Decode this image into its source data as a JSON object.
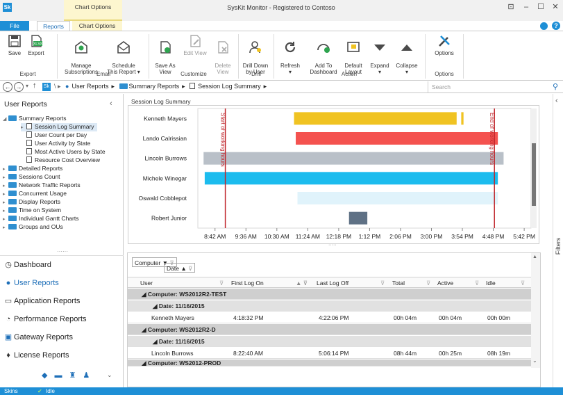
{
  "window": {
    "title": "SysKit Monitor - Registered to Contoso",
    "context_header": "Chart Options",
    "app_icon": "Sk"
  },
  "tabs": [
    {
      "label": "File"
    },
    {
      "label": "Reports"
    },
    {
      "label": "Chart Options"
    }
  ],
  "ribbon": {
    "buttons": [
      {
        "label": "Save",
        "icon": "save-icon"
      },
      {
        "label": "Export",
        "icon": "xlsx-export-icon"
      },
      {
        "label": "Manage\nSubscriptions",
        "icon": "subscriptions-icon"
      },
      {
        "label": "Schedule\nThis Report ▾",
        "icon": "schedule-mail-icon"
      },
      {
        "label": "Save As\nView",
        "icon": "save-view-icon"
      },
      {
        "label": "Edit View",
        "icon": "edit-view-icon"
      },
      {
        "label": "Delete\nView",
        "icon": "delete-view-icon"
      },
      {
        "label": "Drill Down\nby User",
        "icon": "drill-down-icon"
      },
      {
        "label": "Refresh\n▾",
        "icon": "refresh-icon"
      },
      {
        "label": "Add To\nDashboard",
        "icon": "add-dashboard-icon"
      },
      {
        "label": "Default\nLayout",
        "icon": "default-layout-icon"
      },
      {
        "label": "Expand\n▾",
        "icon": "expand-icon"
      },
      {
        "label": "Collapse\n▾",
        "icon": "collapse-icon"
      },
      {
        "label": "Options",
        "icon": "options-tools-icon"
      }
    ],
    "groups": [
      "Export",
      "Email",
      "Customize",
      "Drill",
      "Action",
      "Options"
    ]
  },
  "address": {
    "crumbs": [
      "User Reports",
      "Summary Reports",
      "Session Log Summary"
    ],
    "search_placeholder": "Search"
  },
  "left": {
    "title": "User Reports",
    "tree": [
      {
        "label": "Summary Reports",
        "kind": "folder"
      },
      {
        "label": "Session Log Summary",
        "kind": "report",
        "selected": true
      },
      {
        "label": "User Count per Day",
        "kind": "report"
      },
      {
        "label": "User Activity by State",
        "kind": "report"
      },
      {
        "label": "Most Active Users by State",
        "kind": "report"
      },
      {
        "label": "Resource Cost Overview",
        "kind": "report"
      },
      {
        "label": "Detailed Reports",
        "kind": "folder"
      },
      {
        "label": "Sessions Count",
        "kind": "folder"
      },
      {
        "label": "Network Traffic Reports",
        "kind": "folder"
      },
      {
        "label": "Concurrent Usage",
        "kind": "folder"
      },
      {
        "label": "Display Reports",
        "kind": "folder"
      },
      {
        "label": "Time on System",
        "kind": "folder"
      },
      {
        "label": "Individual Gantt Charts",
        "kind": "folder"
      },
      {
        "label": "Groups and OUs",
        "kind": "folder"
      }
    ],
    "nav": [
      {
        "label": "Dashboard",
        "icon": "dashboard-icon"
      },
      {
        "label": "User Reports",
        "icon": "user-icon",
        "active": true
      },
      {
        "label": "Application Reports",
        "icon": "application-icon"
      },
      {
        "label": "Performance Reports",
        "icon": "performance-icon"
      },
      {
        "label": "Gateway Reports",
        "icon": "gateway-icon"
      },
      {
        "label": "License Reports",
        "icon": "license-icon"
      }
    ]
  },
  "chart_title": "Session Log Summary",
  "chart_data": {
    "type": "bar",
    "title": "",
    "users": [
      "Kenneth Mayers",
      "Lando Calrissian",
      "Lincoln Burrows",
      "Michele Winegar",
      "Oswald Cobblepot",
      "Robert Junior"
    ],
    "x_ticks": [
      "8:42 AM",
      "9:36 AM",
      "10:30 AM",
      "11:24 AM",
      "12:18 PM",
      "1:12 PM",
      "2:06 PM",
      "3:00 PM",
      "3:54 PM",
      "4:48 PM",
      "5:42 PM"
    ],
    "xlim": [
      "8:12 AM",
      "5:54 PM"
    ],
    "series": [
      {
        "user": "Kenneth Mayers",
        "segments": [
          [
            "11:00 AM",
            "3:44 PM"
          ],
          [
            "3:52 PM",
            "3:56 PM"
          ]
        ],
        "color": "#f0c322"
      },
      {
        "user": "Lando Calrissian",
        "segments": [
          [
            "11:03 AM",
            "4:56 PM"
          ]
        ],
        "color": "#f4524f"
      },
      {
        "user": "Lincoln Burrows",
        "segments": [
          [
            "8:22 AM",
            "5:06 PM"
          ]
        ],
        "color": "#b9c0c8"
      },
      {
        "user": "Michele Winegar",
        "segments": [
          [
            "8:24 AM",
            "4:56 PM"
          ]
        ],
        "color": "#1cbcee"
      },
      {
        "user": "Oswald Cobblepot",
        "segments": [
          [
            "11:06 AM",
            "4:56 PM"
          ]
        ],
        "color": "#e0f3fb"
      },
      {
        "user": "Robert Junior",
        "segments": [
          [
            "12:36 PM",
            "1:08 PM"
          ]
        ],
        "color": "#5f7185"
      }
    ],
    "markers": [
      {
        "label": "Start of working hours",
        "time": "9:00 AM"
      },
      {
        "label": "End of working hours",
        "time": "4:50 PM"
      }
    ]
  },
  "grid": {
    "group_chips": [
      "Computer ▼",
      "Date ▲"
    ],
    "headers": [
      "User",
      "First Log On",
      "Last Log Off",
      "Total",
      "Active",
      "Idle"
    ],
    "rows": [
      {
        "type": "group",
        "text": "Computer: WS2012R2-TEST"
      },
      {
        "type": "subgroup",
        "text": "Date: 11/16/2015"
      },
      {
        "type": "data",
        "cells": [
          "Kenneth Mayers",
          "4:18:32 PM",
          "4:22:06 PM",
          "00h 04m",
          "00h 04m",
          "00h 00m"
        ]
      },
      {
        "type": "group",
        "text": "Computer: WS2012R2-D"
      },
      {
        "type": "subgroup",
        "text": "Date: 11/16/2015"
      },
      {
        "type": "data",
        "cells": [
          "Lincoln Burrows",
          "8:22:40 AM",
          "5:06:14 PM",
          "08h 44m",
          "00h 25m",
          "08h 19m"
        ]
      },
      {
        "type": "group",
        "text": "Computer: WS2012-PROD"
      }
    ]
  },
  "right_strip": {
    "label": "Filters"
  },
  "status": {
    "skins": "Skins",
    "state": "Idle"
  }
}
